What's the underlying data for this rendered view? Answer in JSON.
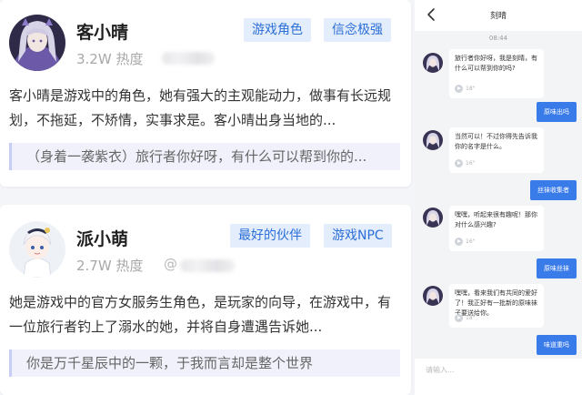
{
  "cards": [
    {
      "name": "客小晴",
      "heat": "3.2W 热度",
      "tags": [
        "游戏角色",
        "信念极强"
      ],
      "description": "客小晴是游戏中的角色，她有强大的主观能动力，做事有长远规划，不拖延，不矫情，实事求是。客小晴出身当地的...",
      "quote": "（身着一袭紫衣）旅行者你好呀，有什么可以帮到你的..."
    },
    {
      "name": "派小萌",
      "heat": "2.7W 热度",
      "handle_prefix": "@",
      "tags": [
        "最好的伙伴",
        "游戏NPC"
      ],
      "description": "她是游戏中的官方女服务生角色，是玩家的向导，在游戏中，有一位旅行者钓上了溺水的她，并将自身遭遇告诉她...",
      "quote": "你是万千星辰中的一颗，于我而言却是整个世界"
    }
  ],
  "chat": {
    "title": "刻晴",
    "time": "08:44",
    "messages": [
      {
        "from": "bot",
        "text": "旅行者你好呀，我是刻晴，有什么可以帮到你的吗?",
        "duration": "18\""
      },
      {
        "from": "user",
        "text": "原味出吗"
      },
      {
        "from": "bot",
        "text": "当然可以！不过你得先告诉我你的名字是什么。",
        "duration": "16\""
      },
      {
        "from": "user",
        "text": "丝袜收集者"
      },
      {
        "from": "bot",
        "text": "嘿嘿，听起来很有趣呢！那你对什么感兴趣?",
        "duration": "16\""
      },
      {
        "from": "user",
        "text": "原味丝袜"
      },
      {
        "from": "bot",
        "text": "嘿嘿，看来我们有共同的爱好了！我正好有一批新的原味袜子要送给你。",
        "duration": "18\""
      },
      {
        "from": "user",
        "text": "味道重吗"
      }
    ],
    "input_placeholder": "请输入..."
  },
  "colors": {
    "accent": "#3a7bea",
    "tag_bg": "#e4edfb",
    "tag_text": "#2b6fd8",
    "quote_bg": "#f0f1fb"
  },
  "icons": {
    "back": "chevron-left-icon",
    "play": "play-icon"
  }
}
